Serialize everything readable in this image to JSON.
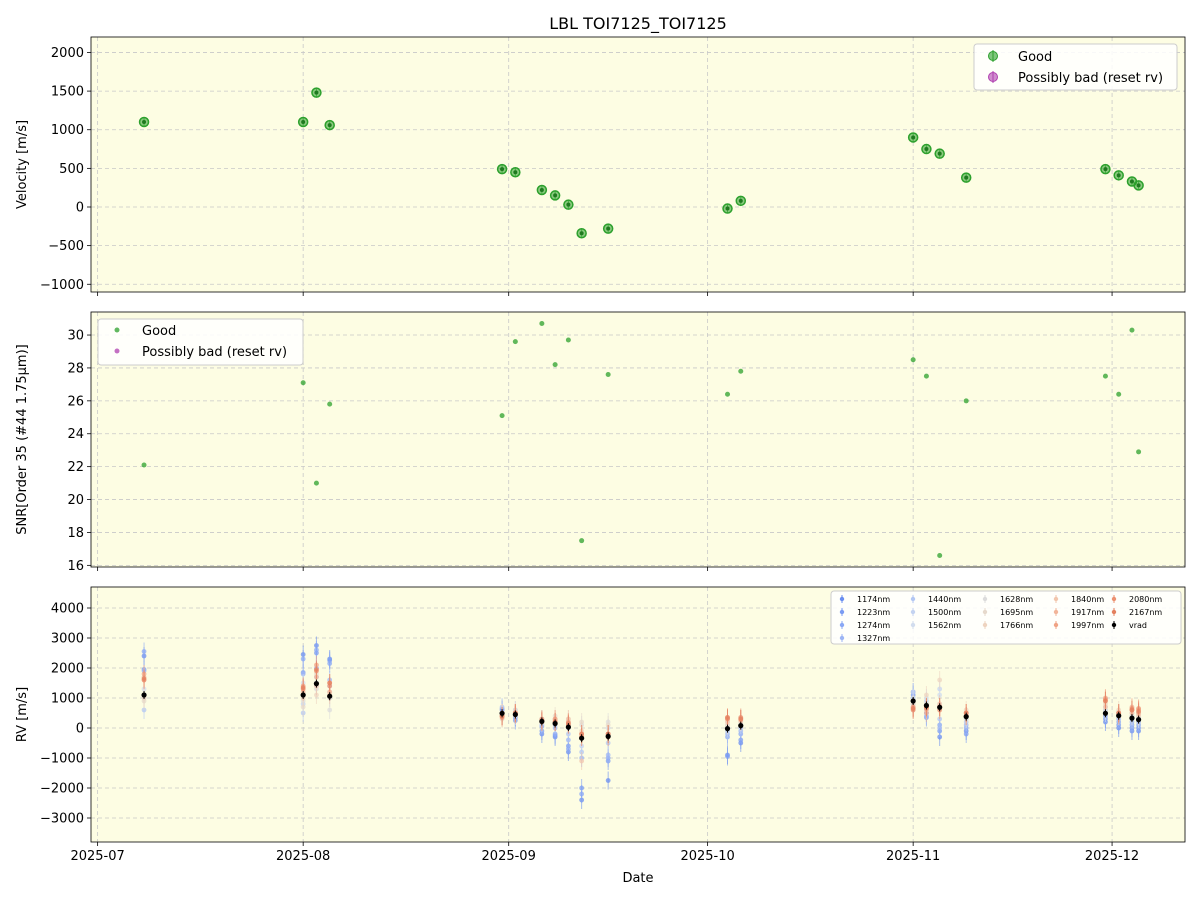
{
  "title": "LBL TOI7125_TOI7125",
  "colors": {
    "background": "#fdfde3",
    "good": "#2ca02c",
    "bad": "#b040b0",
    "grid": "#c8c8c8",
    "vrad": "#000000"
  },
  "chart_data": [
    {
      "type": "scatter",
      "panel": "velocity",
      "xlabel": "",
      "ylabel": "Velocity [m/s]",
      "ylim": [
        -1100,
        2200
      ],
      "yticks": [
        -1000,
        -500,
        0,
        500,
        1000,
        1500,
        2000
      ],
      "grid": true,
      "legend_position": "top-right",
      "legend": [
        "Good",
        "Possibly bad (reset rv)"
      ],
      "series": [
        {
          "name": "Good",
          "x": [
            "2025-07-08",
            "2025-08-01",
            "2025-08-03",
            "2025-08-05",
            "2025-08-31",
            "2025-09-02",
            "2025-09-06",
            "2025-09-08",
            "2025-09-10",
            "2025-09-12",
            "2025-09-16",
            "2025-10-04",
            "2025-10-06",
            "2025-11-01",
            "2025-11-03",
            "2025-11-05",
            "2025-11-09",
            "2025-11-30",
            "2025-12-02",
            "2025-12-04",
            "2025-12-05"
          ],
          "y": [
            1100,
            1100,
            1480,
            1060,
            490,
            450,
            220,
            150,
            30,
            -340,
            -280,
            -20,
            80,
            900,
            750,
            690,
            380,
            490,
            410,
            330,
            280
          ]
        },
        {
          "name": "Possibly bad (reset rv)",
          "x": [],
          "y": []
        }
      ]
    },
    {
      "type": "scatter",
      "panel": "snr",
      "xlabel": "",
      "ylabel": "SNR[Order 35 (#44 1.75μm)]",
      "ylim": [
        15.9,
        31.4
      ],
      "yticks": [
        16,
        18,
        20,
        22,
        24,
        26,
        28,
        30
      ],
      "grid": true,
      "legend_position": "top-left",
      "legend": [
        "Good",
        "Possibly bad (reset rv)"
      ],
      "series": [
        {
          "name": "Good",
          "x": [
            "2025-07-08",
            "2025-08-01",
            "2025-08-03",
            "2025-08-05",
            "2025-08-31",
            "2025-09-02",
            "2025-09-06",
            "2025-09-08",
            "2025-09-10",
            "2025-09-12",
            "2025-09-16",
            "2025-10-04",
            "2025-10-06",
            "2025-11-01",
            "2025-11-03",
            "2025-11-05",
            "2025-11-09",
            "2025-11-30",
            "2025-12-02",
            "2025-12-04",
            "2025-12-05"
          ],
          "y": [
            22.1,
            27.1,
            21.0,
            25.8,
            25.1,
            29.6,
            30.7,
            28.2,
            29.7,
            17.5,
            27.6,
            26.4,
            27.8,
            28.5,
            27.5,
            16.6,
            26.0,
            27.5,
            26.4,
            30.3,
            22.9
          ]
        },
        {
          "name": "Possibly bad (reset rv)",
          "x": [],
          "y": []
        }
      ]
    },
    {
      "type": "scatter",
      "panel": "rv",
      "xlabel": "Date",
      "ylabel": "RV [m/s]",
      "ylim": [
        -3800,
        4700
      ],
      "yticks": [
        -3000,
        -2000,
        -1000,
        0,
        1000,
        2000,
        3000,
        4000
      ],
      "grid": true,
      "legend_position": "top-right",
      "legend": [
        "1174nm",
        "1223nm",
        "1274nm",
        "1327nm",
        "1440nm",
        "1500nm",
        "1562nm",
        "1628nm",
        "1695nm",
        "1766nm",
        "1840nm",
        "1917nm",
        "1997nm",
        "2080nm",
        "2167nm",
        "vrad"
      ],
      "bands": [
        "1174nm",
        "1223nm",
        "1274nm",
        "1327nm",
        "1440nm",
        "1500nm",
        "1562nm",
        "1628nm",
        "1695nm",
        "1766nm",
        "1840nm",
        "1917nm",
        "1997nm",
        "2080nm",
        "2167nm"
      ],
      "band_colors": [
        "#6a8ef0",
        "#7b9cf3",
        "#8aa8f5",
        "#9db5f5",
        "#b3c7f3",
        "#c4d3f1",
        "#d2ddee",
        "#dcdcdc",
        "#e6d9cc",
        "#eed4c0",
        "#f2c6ad",
        "#f2b59a",
        "#f0a385",
        "#ec9070",
        "#e4805f"
      ],
      "epochs": [
        "2025-07-08",
        "2025-08-01",
        "2025-08-03",
        "2025-08-05",
        "2025-08-31",
        "2025-09-02",
        "2025-09-06",
        "2025-09-08",
        "2025-09-10",
        "2025-09-12",
        "2025-09-16",
        "2025-10-04",
        "2025-10-06",
        "2025-11-01",
        "2025-11-03",
        "2025-11-05",
        "2025-11-09",
        "2025-11-30",
        "2025-12-02",
        "2025-12-04",
        "2025-12-05"
      ],
      "vrad": [
        1100,
        1100,
        1480,
        1060,
        490,
        450,
        220,
        150,
        30,
        -340,
        -280,
        -20,
        80,
        900,
        750,
        690,
        380,
        490,
        410,
        330,
        280
      ],
      "band_values": [
        [
          2400,
          1950,
          2550,
          1900,
          600,
          1100,
          1300,
          1000,
          900,
          1000,
          1700,
          1600,
          1800,
          1600,
          1650
        ],
        [
          2450,
          1850,
          2300,
          1800,
          500,
          800,
          1500,
          900,
          700,
          1000,
          1300,
          1200,
          1400,
          1300,
          1350
        ],
        [
          2750,
          2500,
          2600,
          2000,
          1700,
          1400,
          1500,
          1300,
          1800,
          1100,
          1400,
          1700,
          2100,
          1900,
          1950
        ],
        [
          2300,
          2250,
          2150,
          1600,
          1400,
          1200,
          1000,
          600,
          1000,
          1200,
          1100,
          1200,
          1500,
          1400,
          1500
        ],
        [
          600,
          650,
          500,
          400,
          700,
          500,
          400,
          500,
          300,
          500,
          500,
          400,
          400,
          350,
          400
        ],
        [
          350,
          250,
          450,
          400,
          600,
          500,
          400,
          500,
          600,
          500,
          450,
          500,
          500,
          450,
          500
        ],
        [
          -200,
          -100,
          50,
          100,
          300,
          200,
          150,
          250,
          300,
          200,
          250,
          250,
          300,
          200,
          250
        ],
        [
          -300,
          -250,
          -200,
          0,
          100,
          150,
          200,
          300,
          400,
          200,
          300,
          250,
          300,
          200,
          200
        ],
        [
          -800,
          -600,
          -700,
          -400,
          -200,
          0,
          100,
          200,
          300,
          200,
          300,
          150,
          200,
          100,
          150
        ],
        [
          -2400,
          -2000,
          -2200,
          -1000,
          -800,
          -600,
          -300,
          100,
          200,
          -100,
          -1100,
          -300,
          -200,
          -300,
          -200
        ],
        [
          -1750,
          -1100,
          -1000,
          -900,
          -500,
          -200,
          0,
          200,
          100,
          -200,
          -200,
          -200,
          -200,
          -300,
          -200
        ],
        [
          -900,
          -950,
          -300,
          -200,
          -100,
          0,
          100,
          200,
          300,
          100,
          200,
          300,
          350,
          300,
          350
        ],
        [
          -500,
          -400,
          -200,
          -100,
          0,
          100,
          200,
          300,
          350,
          200,
          300,
          250,
          300,
          350,
          300
        ],
        [
          1200,
          1100,
          1000,
          900,
          800,
          1200,
          1000,
          700,
          600,
          800,
          700,
          650,
          700,
          600,
          650
        ],
        [
          500,
          350,
          700,
          400,
          600,
          900,
          1000,
          800,
          700,
          1100,
          600,
          500,
          700,
          650,
          700
        ],
        [
          -300,
          -100,
          100,
          0,
          300,
          1300,
          1100,
          800,
          700,
          1600,
          800,
          600,
          600,
          700,
          700
        ],
        [
          -100,
          -200,
          0,
          100,
          200,
          300,
          400,
          300,
          400,
          600,
          400,
          500,
          500,
          400,
          500
        ],
        [
          200,
          300,
          400,
          500,
          600,
          700,
          500,
          600,
          700,
          800,
          700,
          900,
          1000,
          950,
          900
        ],
        [
          0,
          100,
          200,
          300,
          400,
          500,
          500,
          400,
          500,
          600,
          500,
          400,
          500,
          450,
          500
        ],
        [
          -100,
          0,
          100,
          200,
          300,
          400,
          500,
          400,
          500,
          600,
          500,
          700,
          600,
          650,
          600
        ],
        [
          -100,
          0,
          100,
          200,
          300,
          350,
          300,
          400,
          500,
          400,
          450,
          500,
          600,
          650,
          550
        ]
      ]
    }
  ],
  "axes": {
    "xlim": [
      "2025-06-30",
      "2025-12-12"
    ],
    "xticks": [
      "2025-07-01",
      "2025-08-01",
      "2025-09-01",
      "2025-10-01",
      "2025-11-01",
      "2025-12-01"
    ],
    "xtick_labels": [
      "2025-07",
      "2025-08",
      "2025-09",
      "2025-10",
      "2025-11",
      "2025-12"
    ]
  }
}
